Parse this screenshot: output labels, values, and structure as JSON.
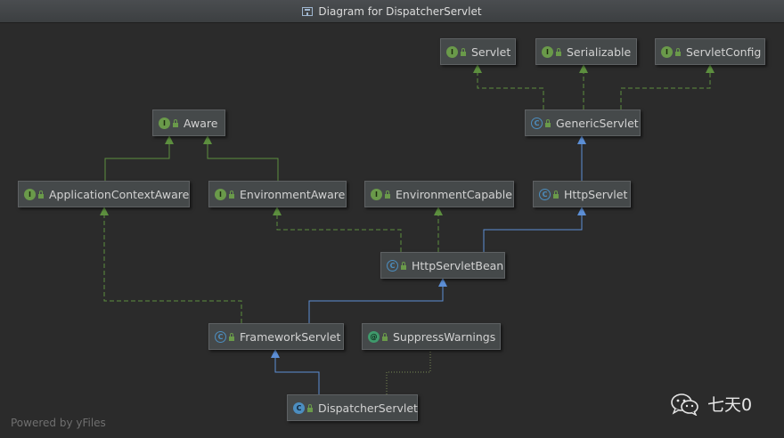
{
  "window": {
    "title": "Diagram for DispatcherServlet"
  },
  "nodes": {
    "servlet": {
      "label": "Servlet",
      "kind": "I"
    },
    "serializable": {
      "label": "Serializable",
      "kind": "I"
    },
    "servlet_config": {
      "label": "ServletConfig",
      "kind": "I"
    },
    "aware": {
      "label": "Aware",
      "kind": "I"
    },
    "generic_servlet": {
      "label": "GenericServlet",
      "kind": "C"
    },
    "application_context_aware": {
      "label": "ApplicationContextAware",
      "kind": "I"
    },
    "environment_aware": {
      "label": "EnvironmentAware",
      "kind": "I"
    },
    "environment_capable": {
      "label": "EnvironmentCapable",
      "kind": "I"
    },
    "http_servlet": {
      "label": "HttpServlet",
      "kind": "C"
    },
    "http_servlet_bean": {
      "label": "HttpServletBean",
      "kind": "C"
    },
    "framework_servlet": {
      "label": "FrameworkServlet",
      "kind": "C"
    },
    "suppress_warnings": {
      "label": "SuppressWarnings",
      "kind": "@"
    },
    "dispatcher_servlet": {
      "label": "DispatcherServlet",
      "kind": "C"
    }
  },
  "colors": {
    "extends_edge": "#5c8fd6",
    "implements_edge": "#5d8f3f",
    "annotation_edge": "#7a8a55"
  },
  "footer": {
    "text": "Powered by yFiles"
  },
  "watermark": {
    "text": "七天0",
    "icon": "wechat-icon"
  }
}
